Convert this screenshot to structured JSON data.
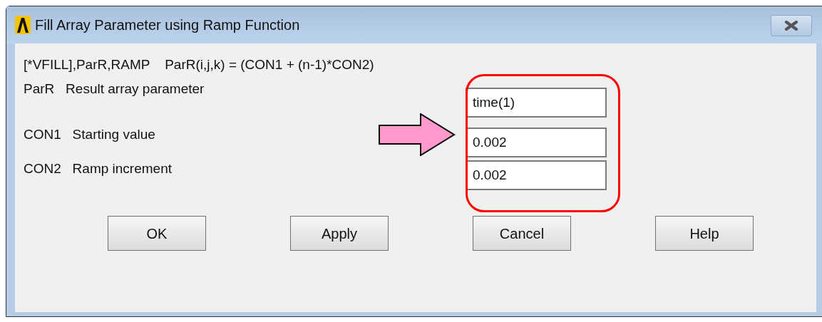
{
  "window": {
    "title": "Fill Array Parameter using Ramp Function"
  },
  "command": "[*VFILL],ParR,RAMP    ParR(i,j,k) = (CON1 + (n-1)*CON2)",
  "params": [
    {
      "code": "ParR",
      "label": "Result array parameter",
      "value": "time(1)"
    },
    {
      "code": "CON1",
      "label": "Starting value",
      "value": "0.002"
    },
    {
      "code": "CON2",
      "label": "Ramp increment",
      "value": "0.002"
    }
  ],
  "buttons": [
    "OK",
    "Apply",
    "Cancel",
    "Help"
  ]
}
